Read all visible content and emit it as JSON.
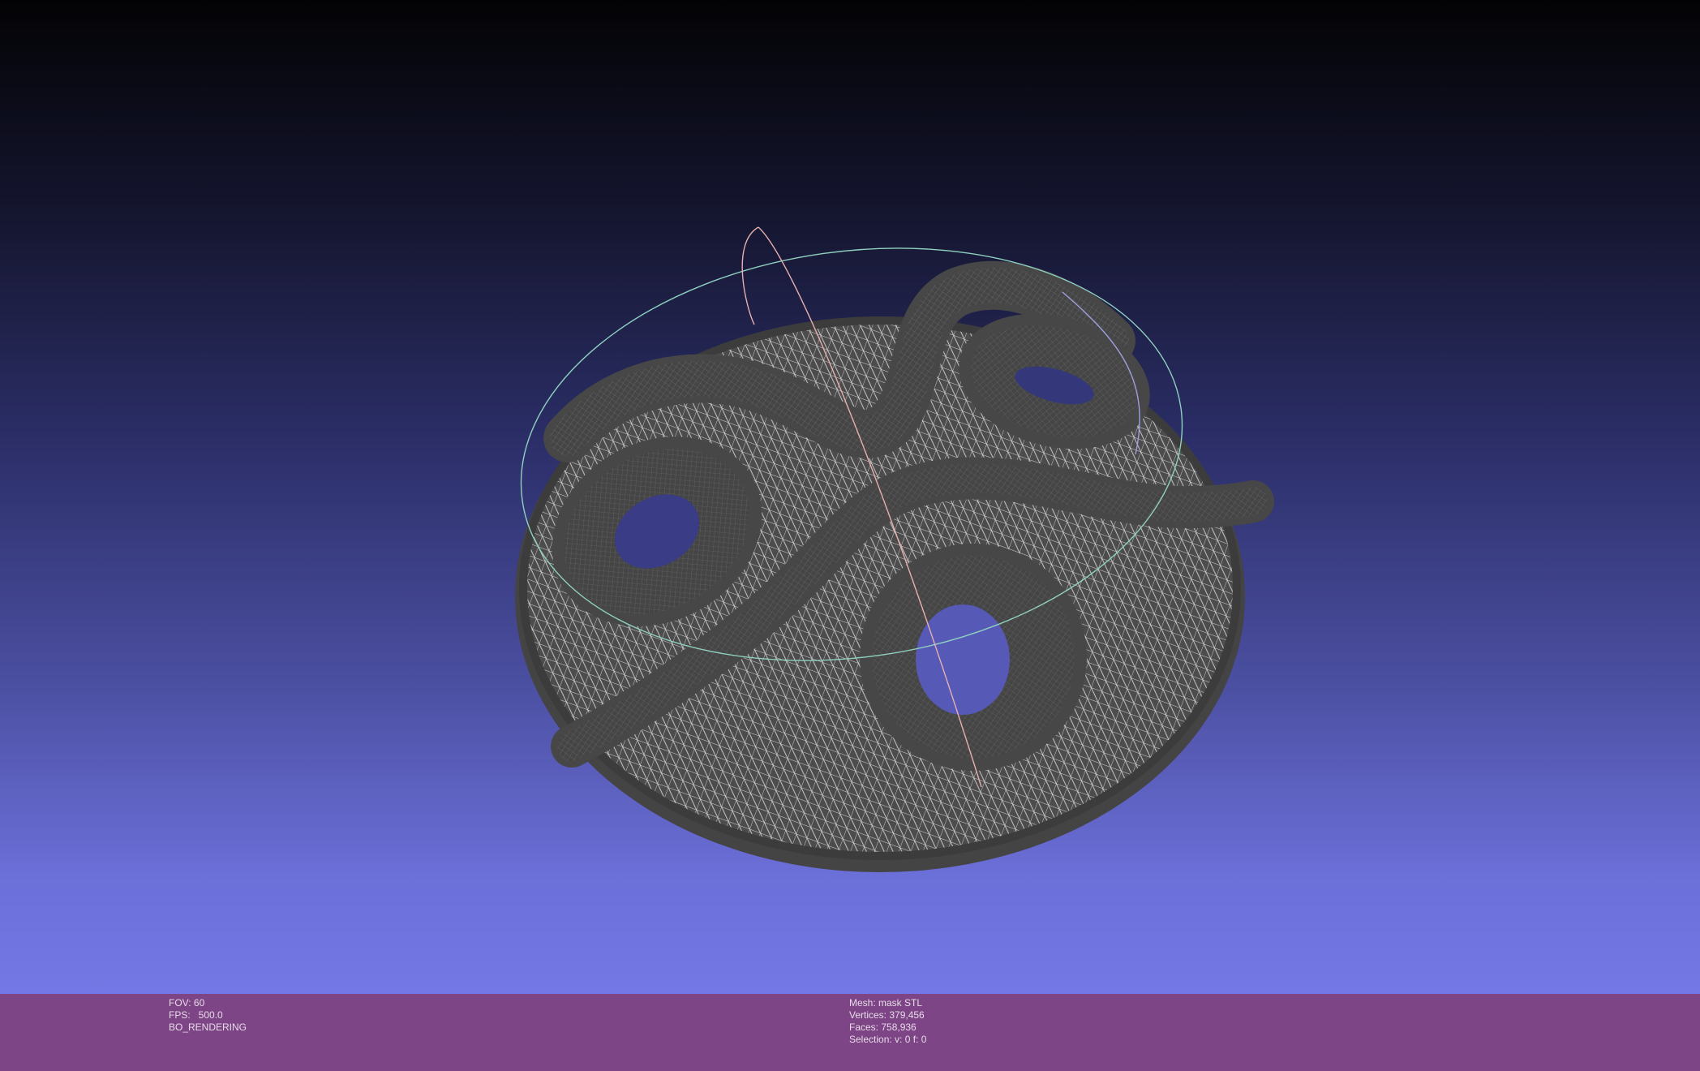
{
  "viewport": {
    "mesh_name": "mask STL",
    "background_top": "#030305",
    "background_bottom": "#7478e6",
    "mesh_color": "#4a4a4a",
    "wire_color": "#d8d8d8"
  },
  "info": {
    "left": {
      "fov": "FOV: 60",
      "fps": "FPS:   500.0",
      "mode": "BO_RENDERING"
    },
    "right": {
      "mesh": "Mesh: mask STL",
      "vertices": "Vertices: 379,456",
      "faces": "Faces: 758,936",
      "selection": "Selection: v: 0 f: 0"
    },
    "bar_color": "#7d4585"
  },
  "trackball": {
    "ring_colors": [
      "#8fd0c0",
      "#e8b0b0",
      "#a0a0e0"
    ]
  }
}
